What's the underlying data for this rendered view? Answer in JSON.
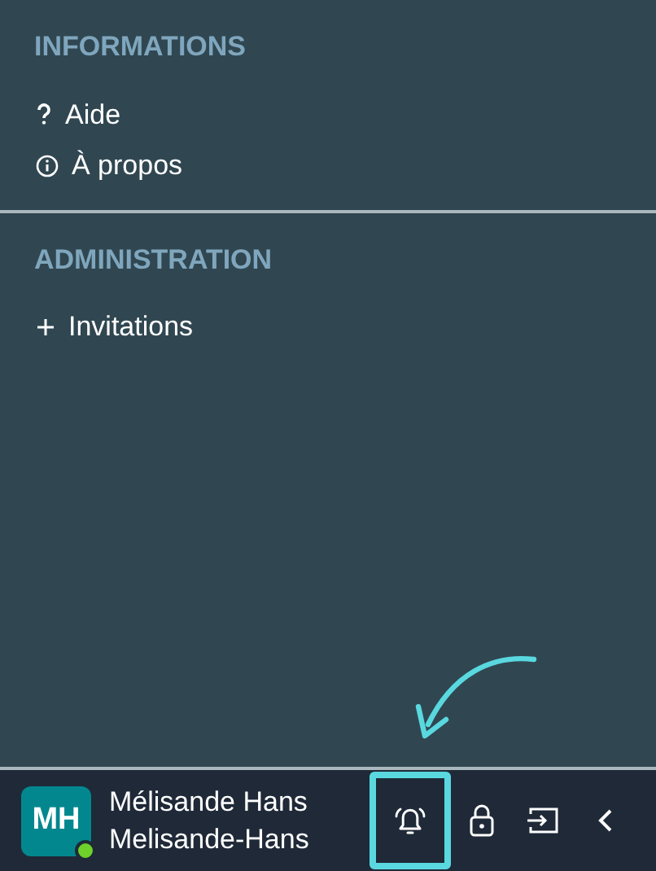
{
  "sections": [
    {
      "title": "INFORMATIONS",
      "items": [
        {
          "kind": "question",
          "label": "Aide"
        },
        {
          "kind": "info",
          "label": "À propos"
        }
      ]
    },
    {
      "title": "ADMINISTRATION",
      "items": [
        {
          "kind": "plus",
          "label": "Invitations"
        }
      ]
    }
  ],
  "user": {
    "initials": "MH",
    "name": "Mélisande Hans",
    "username": "Melisande-Hans",
    "online": true
  },
  "actions": [
    {
      "kind": "bell",
      "highlighted": true
    },
    {
      "kind": "lock",
      "highlighted": false
    },
    {
      "kind": "logout",
      "highlighted": false
    },
    {
      "kind": "collapse",
      "highlighted": false
    }
  ]
}
